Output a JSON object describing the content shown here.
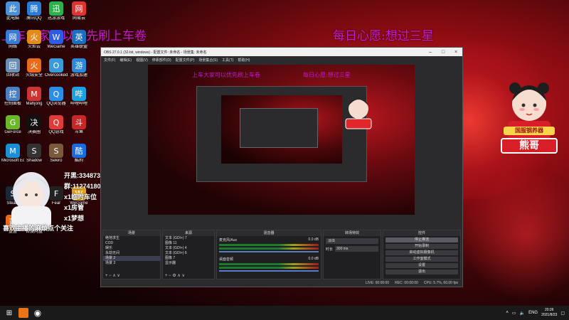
{
  "overlay": {
    "left_title": "上车大家可以优先刷上车卷",
    "right_title": "每日心愿:想过三星",
    "bottom_line": "喜欢主播的麻烦点个关注"
  },
  "stream_info": {
    "lines": [
      "开黑:33487361",
      "群:1127418037",
      "x1临时车位",
      "x1房管",
      "x1梦想"
    ]
  },
  "badge": {
    "sign_text": "熊哥",
    "banner_text": "国服钢养器"
  },
  "desktop_icons": [
    {
      "label": "此电脑",
      "icon": "computer-icon",
      "color": "#4a90d9"
    },
    {
      "label": "腾讯QQ",
      "icon": "qq-icon",
      "color": "#2a7bd6"
    },
    {
      "label": "迅游游戏",
      "icon": "xunyou-icon",
      "color": "#2bb24c"
    },
    {
      "label": "网易云",
      "icon": "netease-icon",
      "color": "#d33"
    },
    {
      "label": "网络",
      "icon": "network-icon",
      "color": "#3a7bd5"
    },
    {
      "label": "火炬云",
      "icon": "torch-icon",
      "color": "#e58a1f"
    },
    {
      "label": "WeGame",
      "icon": "wegame-icon",
      "color": "#2d5be3"
    },
    {
      "label": "英雄联盟",
      "icon": "lol-icon",
      "color": "#1b6fbf"
    },
    {
      "label": "回收站",
      "icon": "recycle-bin-icon",
      "color": "#6a8fb5"
    },
    {
      "label": "火绒安全",
      "icon": "huorong-icon",
      "color": "#e86a1a"
    },
    {
      "label": "Overcooked",
      "icon": "overcooked-icon",
      "color": "#3b9bd9"
    },
    {
      "label": "游戏加速",
      "icon": "accelerator-icon",
      "color": "#2b88d9"
    },
    {
      "label": "控制面板",
      "icon": "control-panel-icon",
      "color": "#4a7fc1"
    },
    {
      "label": "Mahjong",
      "icon": "mahjong-icon",
      "color": "#c33"
    },
    {
      "label": "QQ浏览器",
      "icon": "qq-browser-icon",
      "color": "#2a8de6"
    },
    {
      "label": "哔哩哔哩",
      "icon": "bilibili-icon",
      "color": "#1ba1e2"
    },
    {
      "label": "GeForce",
      "icon": "geforce-icon",
      "color": "#6ab82a"
    },
    {
      "label": "决赛圈",
      "icon": "game-icon",
      "color": "#111"
    },
    {
      "label": "QQ游戏",
      "icon": "qq-game-icon",
      "color": "#e13a3a"
    },
    {
      "label": "斗鱼",
      "icon": "douyu-icon",
      "color": "#c62828"
    },
    {
      "label": "Microsoft Edge",
      "icon": "edge-icon",
      "color": "#1a8fd6"
    },
    {
      "label": "Shadow",
      "icon": "shadow-icon",
      "color": "#333"
    },
    {
      "label": "Sekiro",
      "icon": "sekiro-icon",
      "color": "#7a5a3a"
    },
    {
      "label": "酷狗",
      "icon": "kugou-icon",
      "color": "#1a6be0"
    },
    {
      "label": "Steam",
      "icon": "steam-icon",
      "color": "#1b2838"
    },
    {
      "label": "网易云音乐",
      "icon": "music-icon",
      "color": "#d22"
    },
    {
      "label": "Fear",
      "icon": "fear-icon",
      "color": "#222"
    },
    {
      "label": "WeGame",
      "icon": "wegame2-icon",
      "color": "#e8a21a"
    },
    {
      "label": "蓝叠",
      "icon": "bluestacks-icon",
      "color": "#e86a1a"
    },
    {
      "label": "百度网盘",
      "icon": "baidu-pan-icon",
      "color": "#111"
    }
  ],
  "obs": {
    "title": "OBS 27.0.1 (32-bit, windows) - 配置文件: 未命名 - 场景集: 未命名",
    "menus": [
      "文件(F)",
      "编辑(E)",
      "视图(V)",
      "停靠部件(D)",
      "配置文件(P)",
      "场景集合(S)",
      "工具(T)",
      "帮助(H)"
    ],
    "docks": {
      "scenes_title": "场景",
      "sources_title": "来源",
      "mixer_title": "混音器",
      "transition_title": "转场特效",
      "controls_title": "控件"
    },
    "scenes": [
      "绝地求生",
      "COD",
      "娱乐",
      "永劫无间",
      "场景 2",
      "场景 3"
    ],
    "sources": [
      "文本 (GDI+) 7",
      "图像 11",
      "文本 (GDI+) 4",
      "文本 (GDI+) 6",
      "图像 7",
      "显示器"
    ],
    "mixer": [
      {
        "name": "麦克风/Aux",
        "level": "0.0 dB"
      },
      {
        "name": "桌面音频",
        "level": "0.0 dB"
      }
    ],
    "transition": {
      "type": "淡出",
      "duration_label": "时长",
      "duration": "300 ms"
    },
    "controls": [
      "停止推流",
      "开始录制",
      "启动虚拟摄像机",
      "工作室模式",
      "设置",
      "退出"
    ],
    "status": [
      "LIVE: 00:00:00",
      "REC: 00:00:00",
      "CPU: 5.7%, 60.00 fps"
    ]
  },
  "taskbar": {
    "tray_lang": "ENG",
    "time": "20:26",
    "date": "2021/8/23"
  }
}
